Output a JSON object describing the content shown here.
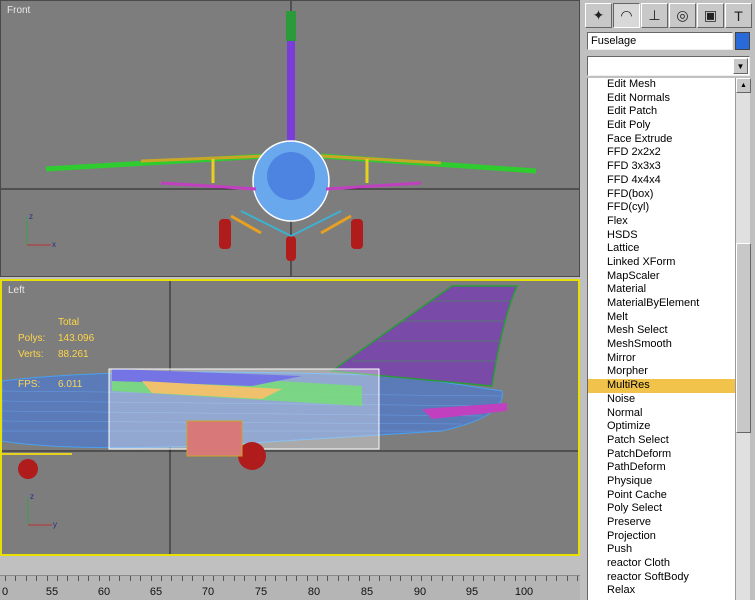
{
  "viewports": {
    "front": {
      "label": "Front"
    },
    "left": {
      "label": "Left",
      "stats": {
        "total_label": "Total",
        "polys_label": "Polys:",
        "polys_value": "143.096",
        "verts_label": "Verts:",
        "verts_value": "88.261",
        "fps_label": "FPS:",
        "fps_value": "6.011"
      }
    }
  },
  "ruler": {
    "labels": [
      "0",
      "55",
      "60",
      "65",
      "70",
      "75",
      "80",
      "85",
      "90",
      "95",
      "100"
    ]
  },
  "command_panel": {
    "tabs": [
      "create-icon",
      "modify-icon",
      "hierarchy-icon",
      "motion-icon",
      "display-icon",
      "utilities-icon"
    ],
    "object_name": "Fuselage",
    "object_color": "#2a6ad8",
    "modifier_dropdown_value": "",
    "modifier_list": [
      "Edit Mesh",
      "Edit Normals",
      "Edit Patch",
      "Edit Poly",
      "Face Extrude",
      "FFD 2x2x2",
      "FFD 3x3x3",
      "FFD 4x4x4",
      "FFD(box)",
      "FFD(cyl)",
      "Flex",
      "HSDS",
      "Lattice",
      "Linked XForm",
      "MapScaler",
      "Material",
      "MaterialByElement",
      "Melt",
      "Mesh Select",
      "MeshSmooth",
      "Mirror",
      "Morpher",
      "MultiRes",
      "Noise",
      "Normal",
      "Optimize",
      "Patch Select",
      "PatchDeform",
      "PathDeform",
      "Physique",
      "Point Cache",
      "Poly Select",
      "Preserve",
      "Projection",
      "Push",
      "reactor Cloth",
      "reactor SoftBody",
      "Relax"
    ],
    "selected_modifier": "MultiRes"
  },
  "colors": {
    "viewport_bg": "#7d7d7d",
    "active_border": "#e8e000",
    "selection": "#f2c34b",
    "stats_text": "#ffd64a"
  }
}
